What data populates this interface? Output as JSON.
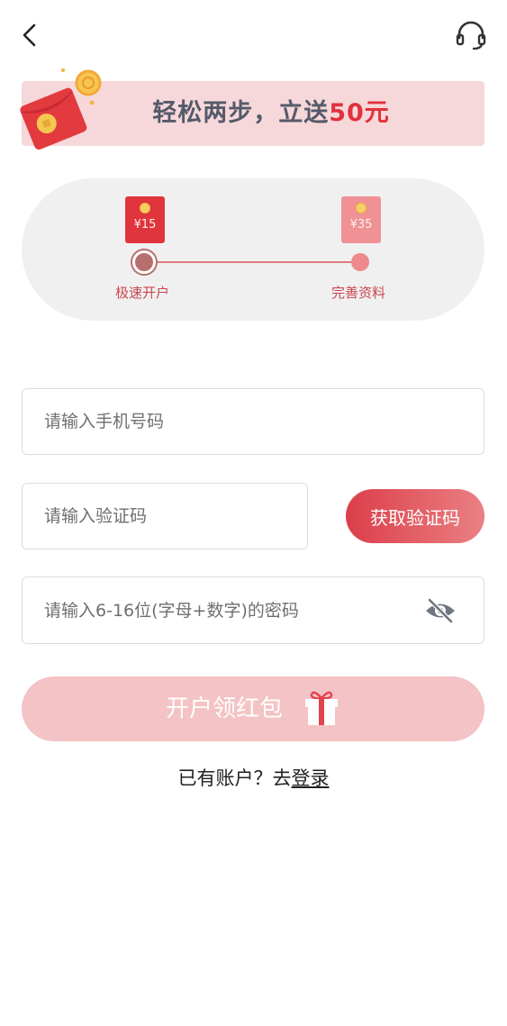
{
  "header": {
    "back_icon": "chevron-left-icon",
    "support_icon": "headset-icon"
  },
  "banner": {
    "text_prefix": "轻松两步，立送",
    "text_highlight": "50元",
    "highlight_color": "#e0323d"
  },
  "steps": {
    "items": [
      {
        "amount": "¥15",
        "label": "极速开户"
      },
      {
        "amount": "¥35",
        "label": "完善资料"
      }
    ]
  },
  "form": {
    "phone_placeholder": "请输入手机号码",
    "code_placeholder": "请输入验证码",
    "get_code_label": "获取验证码",
    "password_placeholder": "请输入6-16位(字母+数字)的密码",
    "password_toggle_icon": "eye-off-icon",
    "submit_label": "开户领红包",
    "submit_icon": "gift-icon"
  },
  "footer": {
    "have_account_text": "已有账户？去",
    "login_link": "登录"
  },
  "colors": {
    "accent": "#e0323d",
    "banner_bg": "#f7d8da",
    "submit_bg": "#f3c3c5"
  }
}
